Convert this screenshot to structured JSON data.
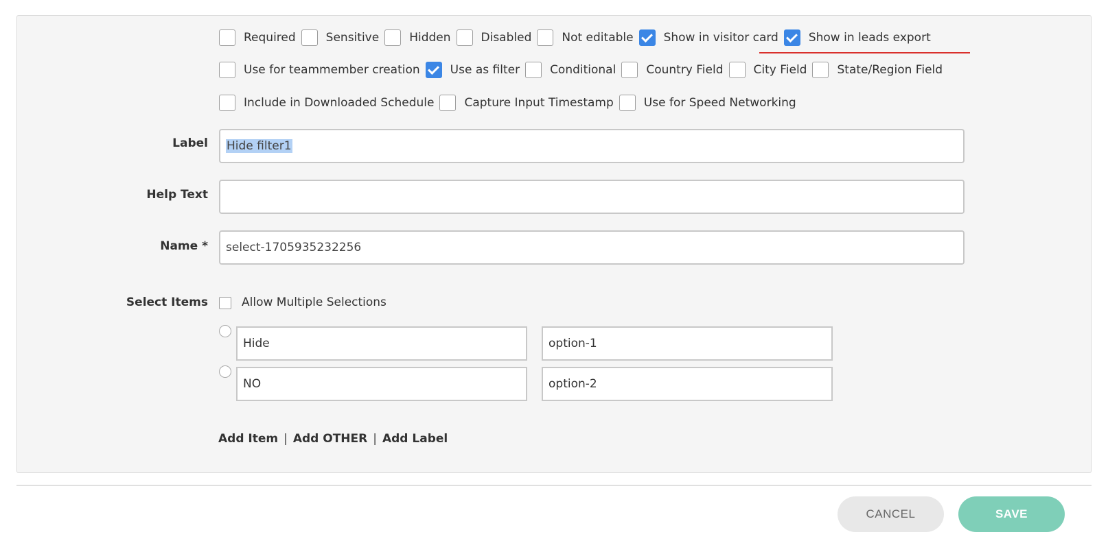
{
  "options_row1": [
    {
      "label": "Required",
      "checked": false
    },
    {
      "label": "Sensitive",
      "checked": false
    },
    {
      "label": "Hidden",
      "checked": false
    },
    {
      "label": "Disabled",
      "checked": false
    },
    {
      "label": "Not editable",
      "checked": false
    },
    {
      "label": "Show in visitor card",
      "checked": true
    },
    {
      "label": "Show in leads export",
      "checked": true
    }
  ],
  "options_row2": [
    {
      "label": "Use for teammember creation",
      "checked": false
    },
    {
      "label": "Use as filter",
      "checked": true
    },
    {
      "label": "Conditional",
      "checked": false
    },
    {
      "label": "Country Field",
      "checked": false
    },
    {
      "label": "City Field",
      "checked": false
    },
    {
      "label": "State/Region Field",
      "checked": false
    }
  ],
  "options_row3": [
    {
      "label": "Include in Downloaded Schedule",
      "checked": false
    },
    {
      "label": "Capture Input Timestamp",
      "checked": false
    },
    {
      "label": "Use for Speed Networking",
      "checked": false
    }
  ],
  "form": {
    "label_label": "Label",
    "label_value": "Hide filter1",
    "help_label": "Help Text",
    "help_value": "",
    "name_label": "Name *",
    "name_value": "select-1705935232256"
  },
  "select_items": {
    "label": "Select Items",
    "allow_multiple": "Allow Multiple Selections",
    "items": [
      {
        "text": "Hide",
        "value": "option-1"
      },
      {
        "text": "NO",
        "value": "option-2"
      }
    ],
    "add_item": "Add Item",
    "add_other": "Add OTHER",
    "add_label": "Add Label",
    "separator": "|"
  },
  "actions": {
    "cancel": "CANCEL",
    "save": "SAVE"
  },
  "colors": {
    "checked": "#3b86e5",
    "save": "#7fcfb8",
    "highlight_line": "#d9302c"
  }
}
